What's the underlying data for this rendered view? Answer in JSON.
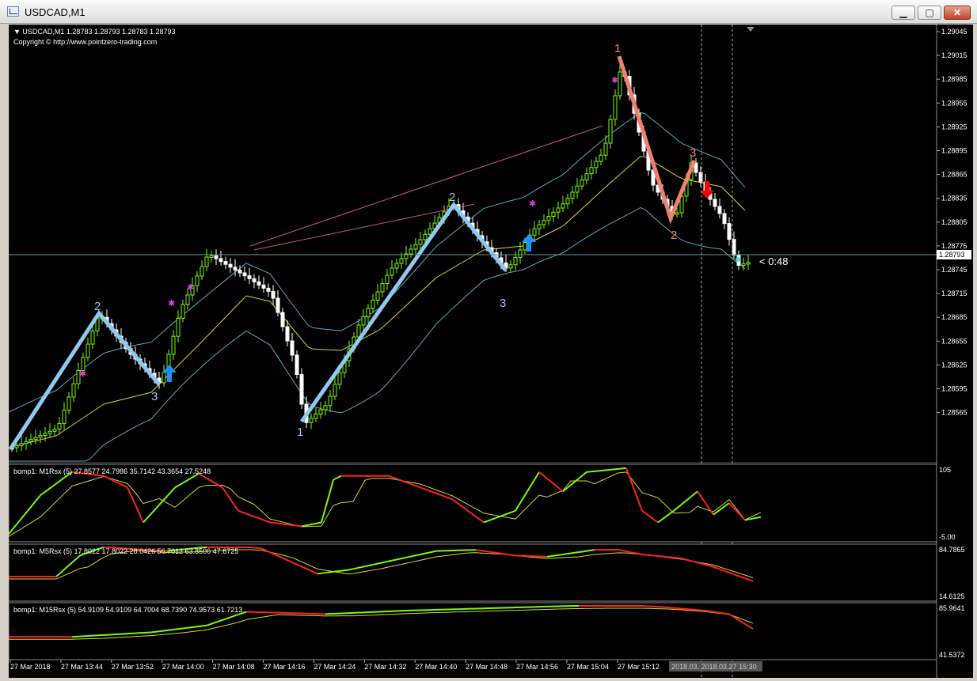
{
  "window": {
    "title": "USDCAD,M1",
    "min_glyph": "▁",
    "max_glyph": "▢",
    "close_glyph": "✕"
  },
  "main": {
    "header": "▼ USDCAD,M1  1.28783 1.28793 1.28783 1.28793",
    "copyright": "Copyright © http://www.pointzero-trading.com",
    "price_labels": [
      "1.29045",
      "1.29015",
      "1.28985",
      "1.28955",
      "1.28925",
      "1.28895",
      "1.28865",
      "1.28835",
      "1.28805",
      "1.28775",
      "1.28745",
      "1.28715",
      "1.28685",
      "1.28655",
      "1.28625",
      "1.28595",
      "1.28565"
    ],
    "current_price": "1.28793",
    "countdown": "< 0:48",
    "wave_labels": {
      "b2a": "2",
      "b3a": "3",
      "b1": "1",
      "b2b": "2",
      "b3b": "3",
      "r1": "1",
      "r2": "2",
      "r3": "3"
    }
  },
  "indicators": [
    {
      "label": "bomp1: M1Rsx (5) 27.8577 24.7986 35.7142 43.3654 27.5248",
      "top_label": "105",
      "bottom_label": "-5.00"
    },
    {
      "label": "bomp1: M5Rsx (5) 17.8022 17.8022 28.0426 56.7012 63.8506 47.6725",
      "top_label": "84.7865",
      "bottom_label": "14.6125"
    },
    {
      "label": "bomp1: M15Rsx (5) 54.9109 54.9109 64.7004 68.7390 74.9573 61.7213",
      "top_label": "85.9641",
      "bottom_label": "41.5372"
    }
  ],
  "time_axis": {
    "labels": [
      "27 Mar 2018",
      "27 Mar 13:44",
      "27 Mar 13:52",
      "27 Mar 14:00",
      "27 Mar 14:08",
      "27 Mar 14:16",
      "27 Mar 14:24",
      "27 Mar 14:32",
      "27 Mar 14:40",
      "27 Mar 14:48",
      "27 Mar 14:56",
      "27 Mar 15:04",
      "27 Mar 15:12"
    ],
    "selection": "2018.03.  2018.03.27 15:30"
  },
  "colors": {
    "bull": "#7cfc00",
    "bear": "#ffffff",
    "band": "#5fa8b8",
    "ma": "#d8d830",
    "wave_up": "#8fc8f0",
    "wave_down": "#f08070",
    "arrow_up": "#1e90ff",
    "arrow_down": "#ff0000"
  }
}
